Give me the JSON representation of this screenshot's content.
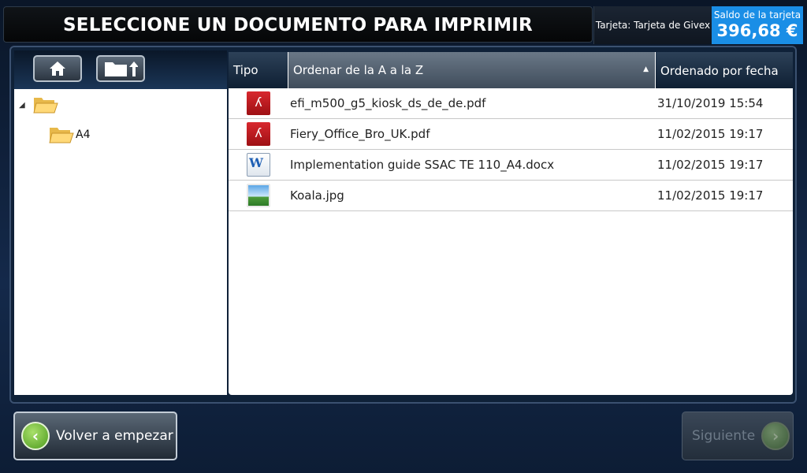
{
  "header": {
    "title": "SELECCIONE UN DOCUMENTO PARA IMPRIMIR",
    "card_label": "Tarjeta: Tarjeta de Givex",
    "balance_label": "Saldo de la tarjeta",
    "balance_value": "396,68 €"
  },
  "tree": {
    "items": [
      {
        "label": ""
      },
      {
        "label": "A4"
      }
    ]
  },
  "list": {
    "columns": {
      "type": "Tipo",
      "name": "Ordenar de la A a la Z",
      "date": "Ordenado por fecha"
    },
    "rows": [
      {
        "icon": "pdf-icon",
        "name": "efi_m500_g5_kiosk_ds_de_de.pdf",
        "date": "31/10/2019 15:54"
      },
      {
        "icon": "pdf-icon",
        "name": "Fiery_Office_Bro_UK.pdf",
        "date": "11/02/2015 19:17"
      },
      {
        "icon": "word-icon",
        "name": "Implementation guide SSAC TE 110_A4.docx",
        "date": "11/02/2015 19:17"
      },
      {
        "icon": "image-icon",
        "name": "Koala.jpg",
        "date": "11/02/2015 19:17"
      }
    ]
  },
  "footer": {
    "restart_label": "Volver a empezar",
    "next_label": "Siguiente"
  },
  "colors": {
    "accent": "#1a8ee6",
    "go_green": "#4d9a1e"
  }
}
